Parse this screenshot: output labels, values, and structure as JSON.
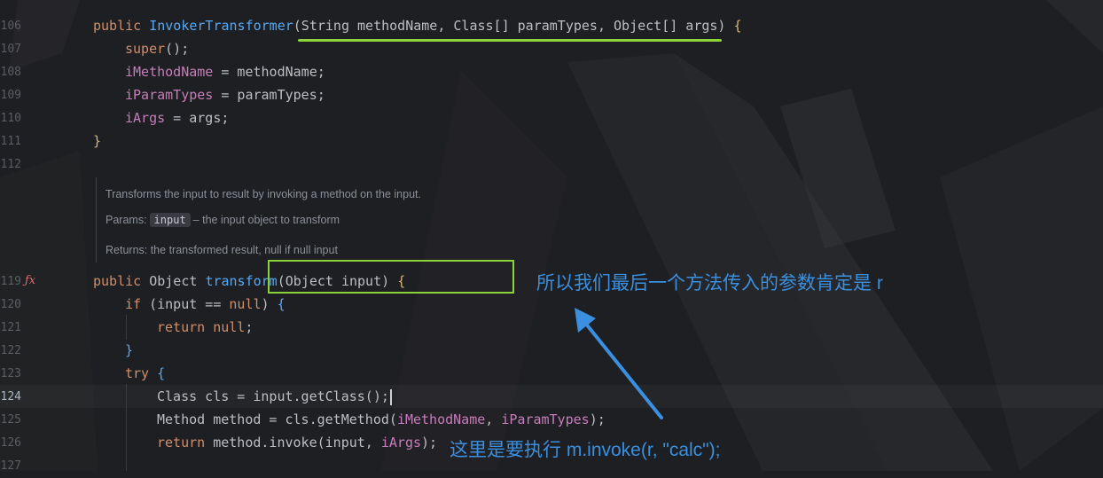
{
  "editor": {
    "line_numbers": [
      "106",
      "107",
      "108",
      "109",
      "110",
      "111",
      "112",
      "119",
      "120",
      "121",
      "122",
      "123",
      "124",
      "125",
      "126",
      "127"
    ],
    "current_line": "124",
    "gutter_icon": "function-override-icon"
  },
  "code": {
    "l106": {
      "t1": "public ",
      "t2": "InvokerTransformer",
      "t3": "(String methodName, Class[] paramTypes, Object[] args) ",
      "t4": "{"
    },
    "l107": {
      "t1": "super",
      "t2": "();"
    },
    "l108": {
      "t1": "iMethodName",
      "t2": " = methodName;"
    },
    "l109": {
      "t1": "iParamTypes",
      "t2": " = paramTypes;"
    },
    "l110": {
      "t1": "iArgs",
      "t2": " = args;"
    },
    "l111": {
      "t1": "}"
    },
    "l119": {
      "t1": "public ",
      "t2": "Object ",
      "t3": "transform",
      "t4": "(Object input) ",
      "t5": "{"
    },
    "l120": {
      "t1": "if ",
      "t2": "(input == ",
      "t3": "null",
      "t4": ") ",
      "t5": "{"
    },
    "l121": {
      "t1": "return null",
      "t2": ";"
    },
    "l122": {
      "t1": "}"
    },
    "l123": {
      "t1": "try ",
      "t2": "{"
    },
    "l124": {
      "t1": "Class cls = input.getClass();"
    },
    "l125": {
      "t1": "Method method = cls.getMethod(",
      "t2": "iMethodName",
      "t3": ", ",
      "t4": "iParamTypes",
      "t5": ");"
    },
    "l126": {
      "t1": "return ",
      "t2": "method.invoke(input, ",
      "t3": "iArgs",
      "t4": ");"
    }
  },
  "doc": {
    "summary": "Transforms the input to result by invoking a method on the input.",
    "params_label": "Params:",
    "param_name": "input",
    "param_desc": "– the input object to transform",
    "returns": "Returns: the transformed result, null if null input"
  },
  "annotations": {
    "note1": "所以我们最后一个方法传入的参数肯定是 r",
    "note2": "这里是要执行 m.invoke(r, \"calc\");"
  },
  "colors": {
    "background": "#1e1f22",
    "keyword": "#cf8e6d",
    "function": "#56a8f5",
    "field": "#c77dbb",
    "annotation_text": "#3a8fe0",
    "marker": "#8cd33a"
  }
}
